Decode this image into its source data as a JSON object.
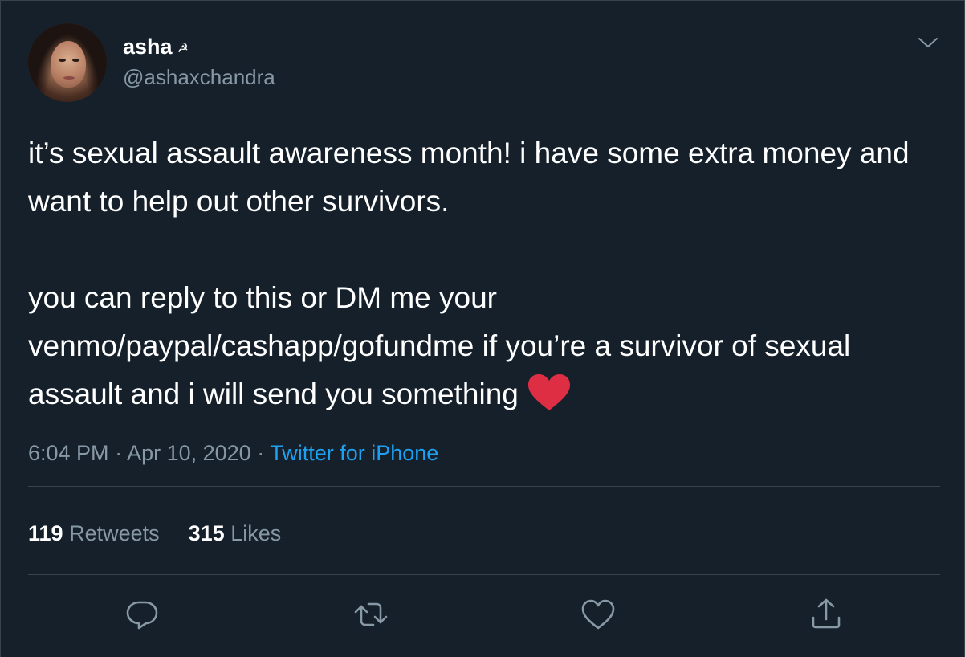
{
  "user": {
    "name": "asha",
    "name_emoji": "☭",
    "handle": "@ashaxchandra"
  },
  "tweet": {
    "text": "it’s sexual assault awareness month! i have some extra money and want to help out other survivors.\n\nyou can reply to this or DM me your venmo/paypal/cashapp/gofundme if you’re a survivor of sexual assault and i will send you something",
    "emoji": "red-heart"
  },
  "meta": {
    "time": "6:04 PM",
    "separator": " · ",
    "date": "Apr 10, 2020",
    "source": "Twitter for iPhone"
  },
  "stats": {
    "retweets_count": "119",
    "retweets_label": "Retweets",
    "likes_count": "315",
    "likes_label": "Likes"
  },
  "actions": {
    "reply_icon": "reply-icon",
    "retweet_icon": "retweet-icon",
    "like_icon": "heart-icon",
    "share_icon": "share-icon",
    "more_icon": "chevron-down-icon"
  },
  "colors": {
    "background": "#15202b",
    "text": "#ffffff",
    "secondary": "#8899a6",
    "link": "#1da1f2",
    "border": "#38444d",
    "heart": "#dd2e44"
  }
}
